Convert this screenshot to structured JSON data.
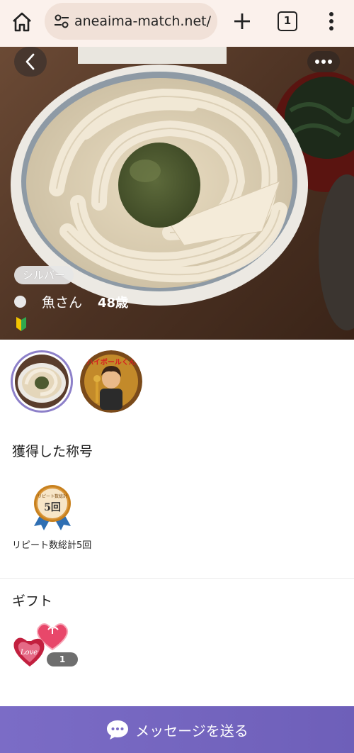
{
  "browser": {
    "url": "aneaima-match.net/",
    "tab_count": "1"
  },
  "profile": {
    "rank_badge": "シルバー",
    "name": "魚さん",
    "age": "48歳",
    "status_color": "#e8e8e8"
  },
  "sections": {
    "titles_heading": "獲得した称号",
    "badge_text_top": "リピート数総計",
    "badge_text_main": "5回",
    "badge_label": "リピート数総計5回",
    "gifts_heading": "ギフト",
    "gift_count": "1"
  },
  "thumb2_text": "ハイボールくん",
  "action": {
    "send_message": "メッセージを送る"
  },
  "colors": {
    "accent": "#7b6cc6",
    "chrome_bg": "#fbf1ec"
  }
}
